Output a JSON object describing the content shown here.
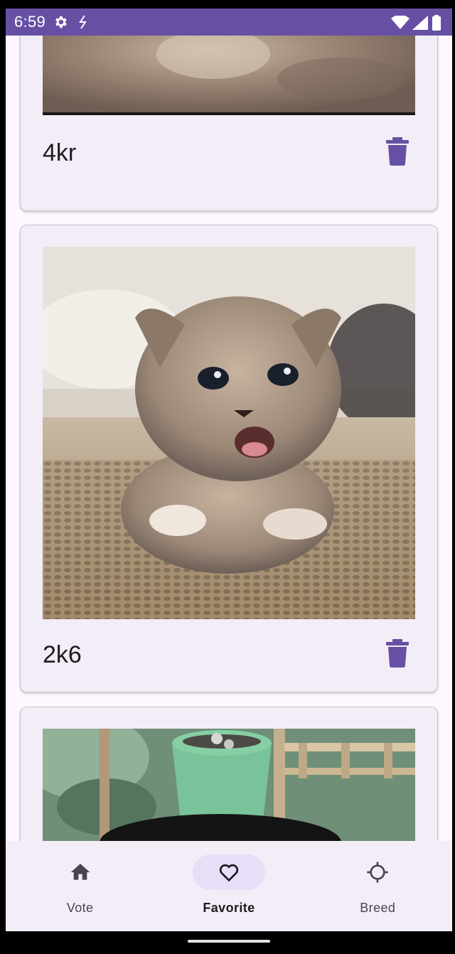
{
  "status_bar": {
    "time": "6:59",
    "icons": [
      "gear-icon",
      "bolt-icon",
      "wifi-icon",
      "cell-signal-icon",
      "battery-icon"
    ],
    "color": "#6750a4"
  },
  "favorites": [
    {
      "label": "4kr",
      "image": "cat-photo",
      "action": "trash-icon"
    },
    {
      "label": "2k6",
      "image": "kitten-meowing-photo",
      "action": "trash-icon"
    },
    {
      "label": "",
      "image": "cat-with-plant-pot-photo",
      "action": ""
    }
  ],
  "bottom_nav": {
    "items": [
      {
        "label": "Vote",
        "icon": "home-icon",
        "active": false
      },
      {
        "label": "Favorite",
        "icon": "heart-icon",
        "active": true
      },
      {
        "label": "Breed",
        "icon": "crosshair-icon",
        "active": false
      }
    ]
  },
  "colors": {
    "accent": "#6750a4",
    "card": "#f3edf7",
    "nav_indicator": "#e8def8",
    "text": "#1d1b20"
  }
}
